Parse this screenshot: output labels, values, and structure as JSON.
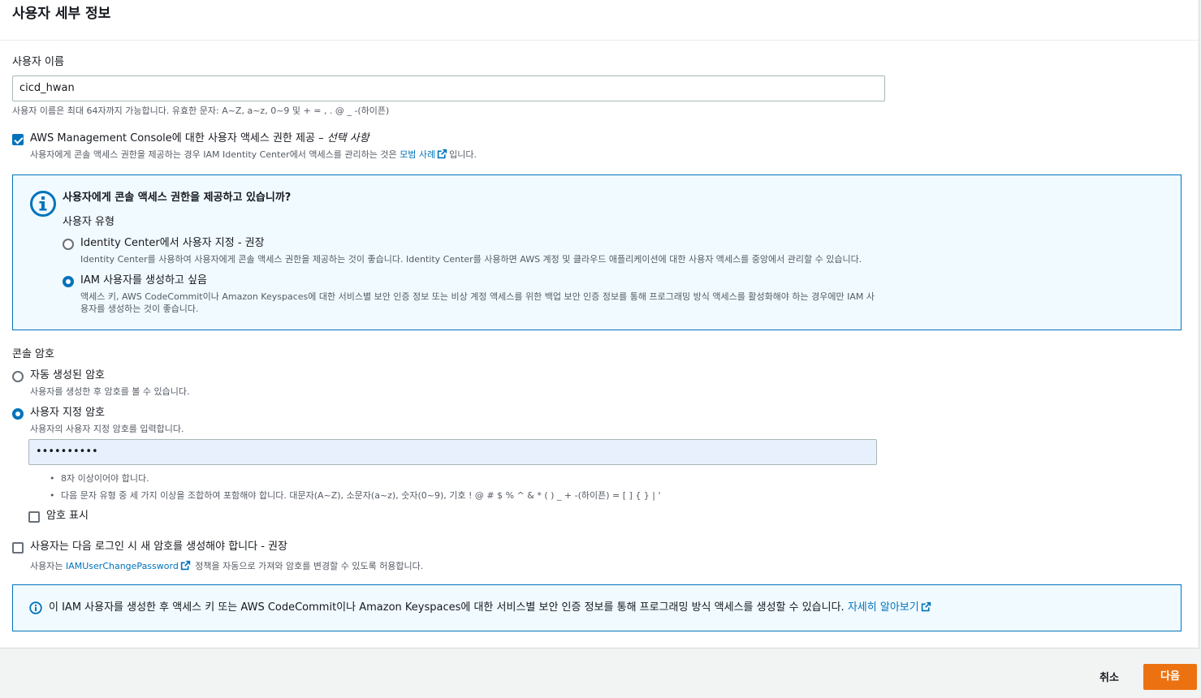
{
  "section": {
    "title": "사용자 세부 정보"
  },
  "username": {
    "label": "사용자 이름",
    "value": "cicd_hwan",
    "hint": "사용자 이름은 최대 64자까지 가능합니다. 유효한 문자: A~Z, a~z, 0~9 및 + = , . @ _ -(하이픈)"
  },
  "console_access": {
    "checked": true,
    "label_main": "AWS Management Console에 대한 사용자 액세스 권한 제공 – ",
    "label_optional": "선택 사항",
    "desc_prefix": "사용자에게 콘솔 액세스 권한을 제공하는 경우 IAM Identity Center에서 액세스를 관리하는 것은 ",
    "desc_link": "모범 사례",
    "desc_suffix": "입니다."
  },
  "user_type_box": {
    "title": "사용자에게 콘솔 액세스 권한을 제공하고 있습니까?",
    "group_label": "사용자 유형",
    "options": [
      {
        "label": "Identity Center에서 사용자 지정 - 권장",
        "desc": "Identity Center를 사용하여 사용자에게 콘솔 액세스 권한을 제공하는 것이 좋습니다. Identity Center를 사용하면 AWS 계정 및 클라우드 애플리케이션에 대한 사용자 액세스를 중앙에서 관리할 수 있습니다.",
        "selected": false
      },
      {
        "label": "IAM 사용자를 생성하고 싶음",
        "desc_line1": "액세스 키, AWS CodeCommit이나 Amazon Keyspaces에 대한 서비스별 보안 인증 정보 또는 비상 계정 액세스를 위한 백업 보안 인증 정보를 통해 프로그래밍 방식 액세스를 활성화해야 하는 경우에만 IAM 사",
        "desc_line2": "용자를 생성하는 것이 좋습니다.",
        "selected": true
      }
    ]
  },
  "console_password": {
    "label": "콘솔 암호",
    "options": [
      {
        "label": "자동 생성된 암호",
        "desc": "사용자를 생성한 후 암호를 볼 수 있습니다.",
        "selected": false
      },
      {
        "label": "사용자 지정 암호",
        "desc": "사용자의 사용자 지정 암호를 입력합니다.",
        "selected": true
      }
    ],
    "value": "••••••••••",
    "rules": [
      "8자 이상이어야 합니다.",
      "다음 문자 유형 중 세 가지 이상을 조합하여 포함해야 합니다. 대문자(A~Z), 소문자(a~z), 숫자(0~9), 기호 ! @ # $ % ^ & * ( ) _ + -(하이픈) = [ ] { } | '"
    ],
    "show_password_label": "암호 표시",
    "show_password_checked": false
  },
  "reset_password": {
    "label": "사용자는 다음 로그인 시 새 암호를 생성해야 합니다 - 권장",
    "checked": false,
    "desc_prefix": "사용자는 ",
    "desc_link": "IAMUserChangePassword",
    "desc_suffix": " 정책을 자동으로 가져와 암호를 변경할 수 있도록 허용합니다."
  },
  "info_note": {
    "text": "이 IAM 사용자를 생성한 후 액세스 키 또는 AWS CodeCommit이나 Amazon Keyspaces에 대한 서비스별 보안 인증 정보를 통해 프로그래밍 방식 액세스를 생성할 수 있습니다.",
    "link": "자세히 알아보기"
  },
  "footer": {
    "cancel": "취소",
    "next": "다음"
  },
  "colors": {
    "accent": "#0073bb",
    "primary_button": "#ec7211",
    "info_bg": "#f1faff"
  }
}
